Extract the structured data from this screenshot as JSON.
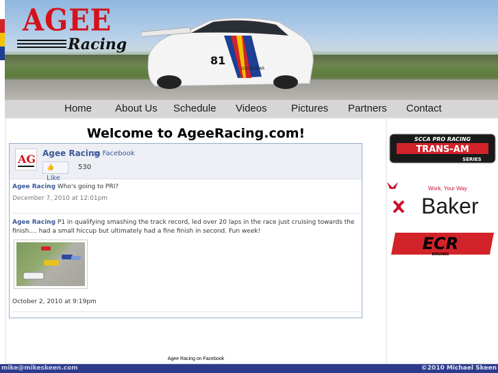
{
  "header": {
    "logo_main": "AGEE",
    "logo_sub": "Racing",
    "car_number": "81",
    "car_sponsor": "GOODYEAR"
  },
  "nav": {
    "items": [
      "Home",
      "About Us",
      "Schedule",
      "Videos",
      "Pictures",
      "Partners",
      "Contact"
    ]
  },
  "main": {
    "welcome": "Welcome to AgeeRacing.com!",
    "fb_footer_link": "Agee Racing on Facebook"
  },
  "facebook": {
    "avatar_text": "AG",
    "page_name": "Agee Racing",
    "on_facebook": "on Facebook",
    "like_label": "Like",
    "like_count": "530",
    "posts": [
      {
        "author": "Agee Racing",
        "text": "Who's going to PRI?",
        "date": "December 7, 2010 at 12:01pm"
      },
      {
        "author": "Agee Racing",
        "text": "P1 in qualifying smashing the track record, led over 20 laps in the race just cruising towards the finish.... had a small hiccup but ultimately had a fine finish in second. Fun week!",
        "date": "October 2, 2010 at 9:19pm"
      }
    ]
  },
  "sponsors": {
    "transam_top": "SCCA PRO RACING",
    "transam_main": "TRANS-AM",
    "transam_bottom": "SERIES",
    "baker_tagline": "Work, Your Way",
    "baker_name": "Baker",
    "ecr_name": "ECR",
    "ecr_sub": "ENGINES"
  },
  "footer": {
    "left": "mike@mikeskeen.com",
    "right": "©2010 Michael Skeen"
  },
  "colors": {
    "accent_red": "#d3121b",
    "footer_blue": "#2d3b8c",
    "fb_blue": "#3b5998"
  }
}
